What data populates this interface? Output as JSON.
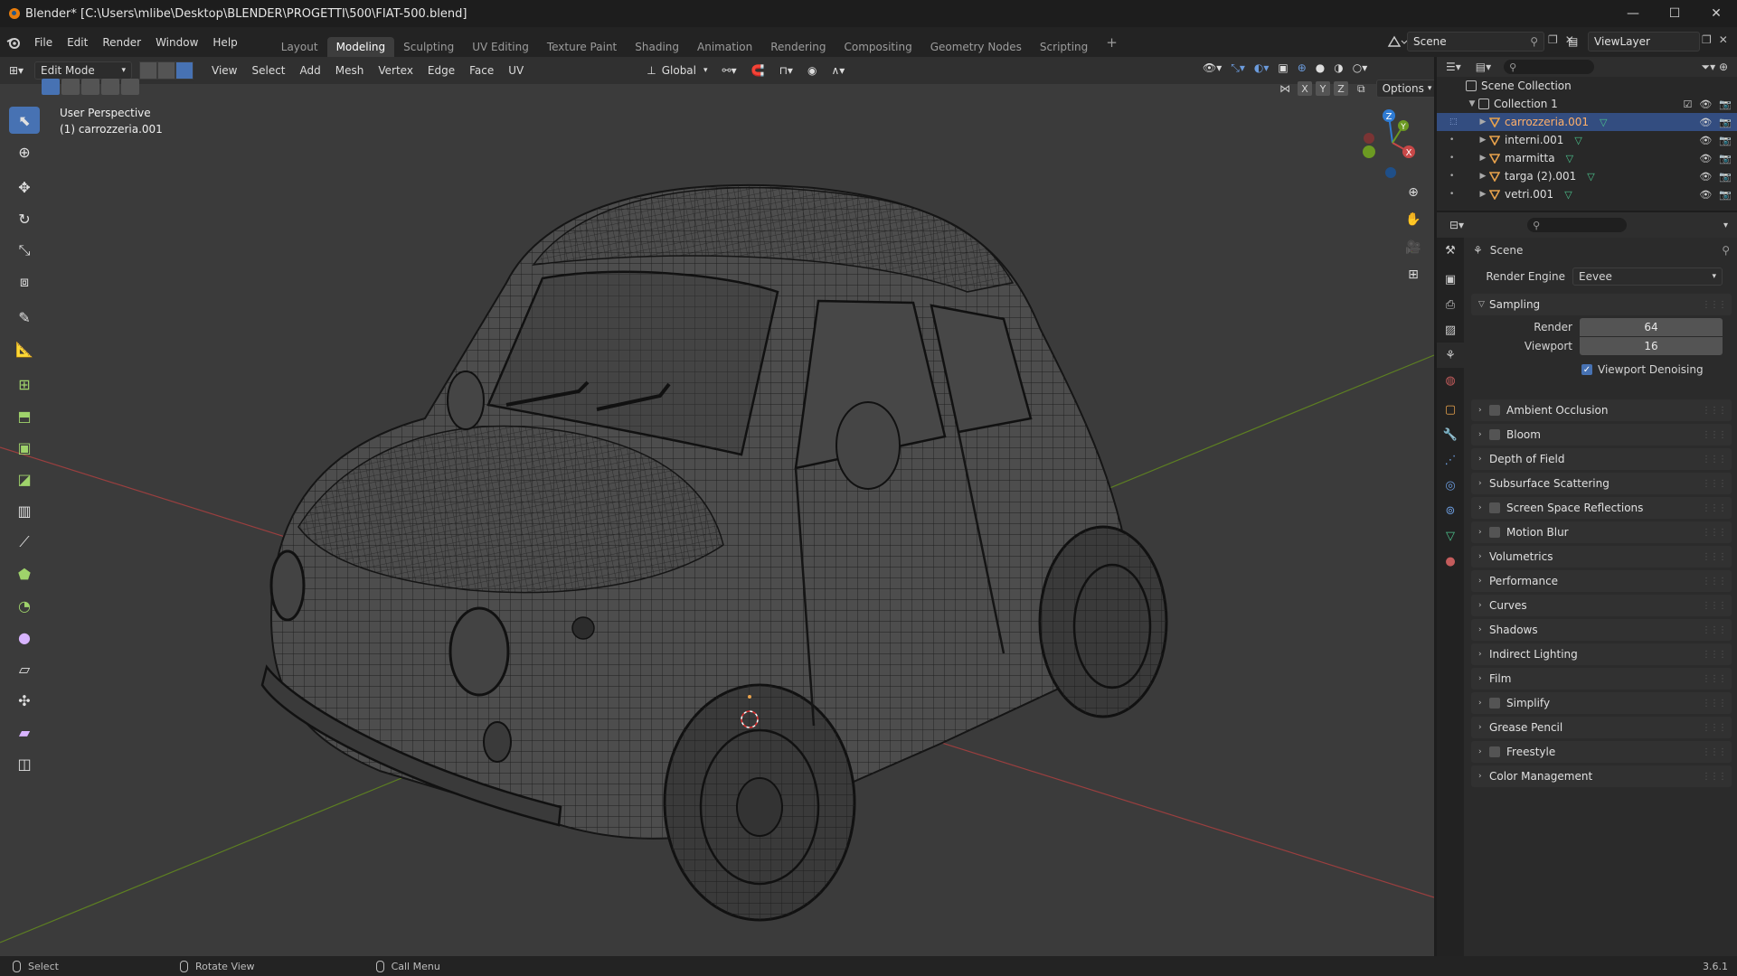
{
  "window": {
    "title": "Blender* [C:\\Users\\mlibe\\Desktop\\BLENDER\\PROGETTI\\500\\FIAT-500.blend]",
    "controls": [
      "—",
      "☐",
      "✕"
    ]
  },
  "menu": [
    "File",
    "Edit",
    "Render",
    "Window",
    "Help"
  ],
  "workspaces": [
    {
      "label": "Layout",
      "active": false
    },
    {
      "label": "Modeling",
      "active": true
    },
    {
      "label": "Sculpting",
      "active": false
    },
    {
      "label": "UV Editing",
      "active": false
    },
    {
      "label": "Texture Paint",
      "active": false
    },
    {
      "label": "Shading",
      "active": false
    },
    {
      "label": "Animation",
      "active": false
    },
    {
      "label": "Rendering",
      "active": false
    },
    {
      "label": "Compositing",
      "active": false
    },
    {
      "label": "Geometry Nodes",
      "active": false
    },
    {
      "label": "Scripting",
      "active": false
    }
  ],
  "add_workspace": "+",
  "scene_name": "Scene",
  "view_layer": "ViewLayer",
  "viewport_header": {
    "mode": "Edit Mode",
    "menus": [
      "View",
      "Select",
      "Add",
      "Mesh",
      "Vertex",
      "Edge",
      "Face",
      "UV"
    ],
    "transform_orientation": "Global",
    "axes": [
      "X",
      "Y",
      "Z"
    ],
    "options": "Options"
  },
  "viewport": {
    "perspective": "User Perspective",
    "object": "(1) carrozzeria.001",
    "gizmo_axes": {
      "x": "X",
      "y": "Y",
      "z": "Z"
    }
  },
  "outliner": {
    "scene_collection": "Scene Collection",
    "collection": "Collection 1",
    "objects": [
      {
        "name": "carrozzeria.001",
        "selected": true
      },
      {
        "name": "interni.001",
        "selected": false
      },
      {
        "name": "marmitta",
        "selected": false
      },
      {
        "name": "targa (2).001",
        "selected": false
      },
      {
        "name": "vetri.001",
        "selected": false
      }
    ]
  },
  "properties": {
    "context": "Scene",
    "render_engine_label": "Render Engine",
    "render_engine": "Eevee",
    "sampling": {
      "label": "Sampling",
      "render_label": "Render",
      "render_value": "64",
      "viewport_label": "Viewport",
      "viewport_value": "16",
      "denoising_label": "Viewport Denoising",
      "denoising_checked": true
    },
    "panels": [
      {
        "label": "Ambient Occlusion",
        "checkbox": true
      },
      {
        "label": "Bloom",
        "checkbox": true
      },
      {
        "label": "Depth of Field",
        "checkbox": false
      },
      {
        "label": "Subsurface Scattering",
        "checkbox": false
      },
      {
        "label": "Screen Space Reflections",
        "checkbox": true
      },
      {
        "label": "Motion Blur",
        "checkbox": true
      },
      {
        "label": "Volumetrics",
        "checkbox": false
      },
      {
        "label": "Performance",
        "checkbox": false
      },
      {
        "label": "Curves",
        "checkbox": false
      },
      {
        "label": "Shadows",
        "checkbox": false
      },
      {
        "label": "Indirect Lighting",
        "checkbox": false
      },
      {
        "label": "Film",
        "checkbox": false
      },
      {
        "label": "Simplify",
        "checkbox": true
      },
      {
        "label": "Grease Pencil",
        "checkbox": false
      },
      {
        "label": "Freestyle",
        "checkbox": true
      },
      {
        "label": "Color Management",
        "checkbox": false
      }
    ]
  },
  "statusbar": {
    "select": "Select",
    "rotate": "Rotate View",
    "menu": "Call Menu",
    "version": "3.6.1"
  },
  "colors": {
    "accent": "#4772b3",
    "selection": "#334d80",
    "object_orange": "#e8a24c",
    "axis_x": "#c84848",
    "axis_y": "#6c9a22",
    "axis_z": "#2f7bd3"
  }
}
